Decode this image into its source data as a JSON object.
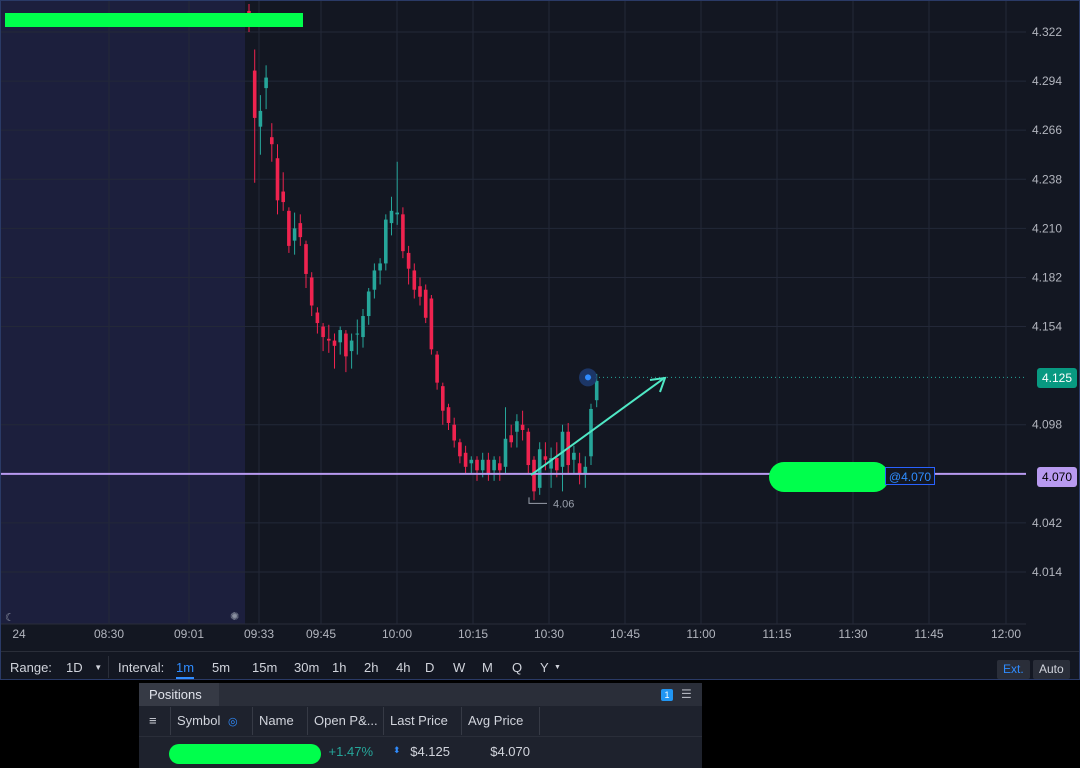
{
  "chart": {
    "y_ticks": [
      "4.322",
      "4.294",
      "4.266",
      "4.238",
      "4.210",
      "4.182",
      "4.154",
      "4.098",
      "4.042",
      "4.014"
    ],
    "last_price_tag": "4.125",
    "avg_price_tag": "4.070",
    "order_label": "@4.070",
    "low_marker_label": "4.06",
    "time_ticks": [
      "24",
      "08:30",
      "09:01",
      "09:33",
      "09:45",
      "10:00",
      "10:15",
      "10:30",
      "10:45",
      "11:00",
      "11:15",
      "11:30",
      "11:45",
      "12:00"
    ],
    "colors": {
      "up": "#26a69a",
      "down": "#ef234f",
      "avg_line": "#b89af0",
      "arrow": "#4fe8c5",
      "premarket_bg": "#1c1f3d"
    }
  },
  "chart_data": {
    "type": "candlestick",
    "ylim": [
      3.995,
      4.335
    ],
    "candles": [
      {
        "o": 4.334,
        "h": 4.338,
        "l": 4.322,
        "c": 4.326
      },
      {
        "o": 4.3,
        "h": 4.312,
        "l": 4.236,
        "c": 4.273
      },
      {
        "o": 4.268,
        "h": 4.286,
        "l": 4.252,
        "c": 4.277
      },
      {
        "o": 4.29,
        "h": 4.303,
        "l": 4.278,
        "c": 4.296
      },
      {
        "o": 4.262,
        "h": 4.27,
        "l": 4.248,
        "c": 4.258
      },
      {
        "o": 4.25,
        "h": 4.258,
        "l": 4.218,
        "c": 4.226
      },
      {
        "o": 4.231,
        "h": 4.242,
        "l": 4.22,
        "c": 4.225
      },
      {
        "o": 4.22,
        "h": 4.222,
        "l": 4.196,
        "c": 4.2
      },
      {
        "o": 4.203,
        "h": 4.219,
        "l": 4.195,
        "c": 4.21
      },
      {
        "o": 4.213,
        "h": 4.218,
        "l": 4.2,
        "c": 4.205
      },
      {
        "o": 4.201,
        "h": 4.203,
        "l": 4.176,
        "c": 4.184
      },
      {
        "o": 4.182,
        "h": 4.185,
        "l": 4.16,
        "c": 4.166
      },
      {
        "o": 4.162,
        "h": 4.165,
        "l": 4.15,
        "c": 4.156
      },
      {
        "o": 4.154,
        "h": 4.156,
        "l": 4.14,
        "c": 4.148
      },
      {
        "o": 4.147,
        "h": 4.155,
        "l": 4.139,
        "c": 4.146
      },
      {
        "o": 4.146,
        "h": 4.15,
        "l": 4.13,
        "c": 4.143
      },
      {
        "o": 4.145,
        "h": 4.154,
        "l": 4.138,
        "c": 4.152
      },
      {
        "o": 4.15,
        "h": 4.152,
        "l": 4.128,
        "c": 4.137
      },
      {
        "o": 4.14,
        "h": 4.15,
        "l": 4.13,
        "c": 4.146
      },
      {
        "o": 4.15,
        "h": 4.158,
        "l": 4.138,
        "c": 4.15
      },
      {
        "o": 4.148,
        "h": 4.164,
        "l": 4.142,
        "c": 4.16
      },
      {
        "o": 4.16,
        "h": 4.176,
        "l": 4.155,
        "c": 4.174
      },
      {
        "o": 4.175,
        "h": 4.19,
        "l": 4.17,
        "c": 4.186
      },
      {
        "o": 4.186,
        "h": 4.193,
        "l": 4.178,
        "c": 4.19
      },
      {
        "o": 4.19,
        "h": 4.218,
        "l": 4.186,
        "c": 4.215
      },
      {
        "o": 4.213,
        "h": 4.228,
        "l": 4.206,
        "c": 4.22
      },
      {
        "o": 4.218,
        "h": 4.248,
        "l": 4.212,
        "c": 4.219
      },
      {
        "o": 4.218,
        "h": 4.222,
        "l": 4.193,
        "c": 4.197
      },
      {
        "o": 4.196,
        "h": 4.2,
        "l": 4.178,
        "c": 4.187
      },
      {
        "o": 4.186,
        "h": 4.19,
        "l": 4.17,
        "c": 4.175
      },
      {
        "o": 4.177,
        "h": 4.182,
        "l": 4.166,
        "c": 4.171
      },
      {
        "o": 4.175,
        "h": 4.178,
        "l": 4.156,
        "c": 4.159
      },
      {
        "o": 4.17,
        "h": 4.172,
        "l": 4.138,
        "c": 4.141
      },
      {
        "o": 4.138,
        "h": 4.14,
        "l": 4.118,
        "c": 4.122
      },
      {
        "o": 4.12,
        "h": 4.122,
        "l": 4.098,
        "c": 4.106
      },
      {
        "o": 4.108,
        "h": 4.11,
        "l": 4.095,
        "c": 4.099
      },
      {
        "o": 4.098,
        "h": 4.102,
        "l": 4.085,
        "c": 4.089
      },
      {
        "o": 4.088,
        "h": 4.09,
        "l": 4.076,
        "c": 4.08
      },
      {
        "o": 4.082,
        "h": 4.086,
        "l": 4.07,
        "c": 4.074
      },
      {
        "o": 4.076,
        "h": 4.08,
        "l": 4.07,
        "c": 4.078
      },
      {
        "o": 4.078,
        "h": 4.08,
        "l": 4.066,
        "c": 4.072
      },
      {
        "o": 4.072,
        "h": 4.082,
        "l": 4.068,
        "c": 4.078
      },
      {
        "o": 4.078,
        "h": 4.082,
        "l": 4.066,
        "c": 4.07
      },
      {
        "o": 4.072,
        "h": 4.08,
        "l": 4.066,
        "c": 4.078
      },
      {
        "o": 4.076,
        "h": 4.08,
        "l": 4.066,
        "c": 4.072
      },
      {
        "o": 4.074,
        "h": 4.108,
        "l": 4.07,
        "c": 4.09
      },
      {
        "o": 4.092,
        "h": 4.098,
        "l": 4.085,
        "c": 4.088
      },
      {
        "o": 4.094,
        "h": 4.104,
        "l": 4.085,
        "c": 4.1
      },
      {
        "o": 4.098,
        "h": 4.106,
        "l": 4.089,
        "c": 4.095
      },
      {
        "o": 4.094,
        "h": 4.096,
        "l": 4.07,
        "c": 4.075
      },
      {
        "o": 4.078,
        "h": 4.08,
        "l": 4.055,
        "c": 4.06
      },
      {
        "o": 4.062,
        "h": 4.088,
        "l": 4.058,
        "c": 4.084
      },
      {
        "o": 4.08,
        "h": 4.088,
        "l": 4.072,
        "c": 4.078
      },
      {
        "o": 4.073,
        "h": 4.085,
        "l": 4.062,
        "c": 4.079
      },
      {
        "o": 4.079,
        "h": 4.088,
        "l": 4.068,
        "c": 4.072
      },
      {
        "o": 4.074,
        "h": 4.098,
        "l": 4.06,
        "c": 4.094
      },
      {
        "o": 4.094,
        "h": 4.099,
        "l": 4.07,
        "c": 4.075
      },
      {
        "o": 4.078,
        "h": 4.086,
        "l": 4.07,
        "c": 4.082
      },
      {
        "o": 4.076,
        "h": 4.082,
        "l": 4.064,
        "c": 4.07
      },
      {
        "o": 4.07,
        "h": 4.08,
        "l": 4.062,
        "c": 4.074
      },
      {
        "o": 4.08,
        "h": 4.11,
        "l": 4.075,
        "c": 4.107
      },
      {
        "o": 4.112,
        "h": 4.127,
        "l": 4.108,
        "c": 4.123
      }
    ],
    "avg_price": 4.07,
    "last_price": 4.125,
    "low_marker": 4.06
  },
  "bottom_bar": {
    "range_label": "Range:",
    "range_value": "1D",
    "interval_label": "Interval:",
    "intervals": [
      "1m",
      "5m",
      "15m",
      "30m",
      "1h",
      "2h",
      "4h",
      "D",
      "W",
      "M",
      "Q",
      "Y"
    ],
    "active_interval": "1m",
    "ext_label": "Ext.",
    "auto_label": "Auto"
  },
  "positions": {
    "tab_label": "Positions",
    "count": "1",
    "columns": [
      "Symbol",
      "Name",
      "Open P&...",
      "Last Price",
      "Avg Price"
    ],
    "row": {
      "open_pl": "+1.47%",
      "last_price": "$4.125",
      "avg_price": "$4.070"
    }
  }
}
